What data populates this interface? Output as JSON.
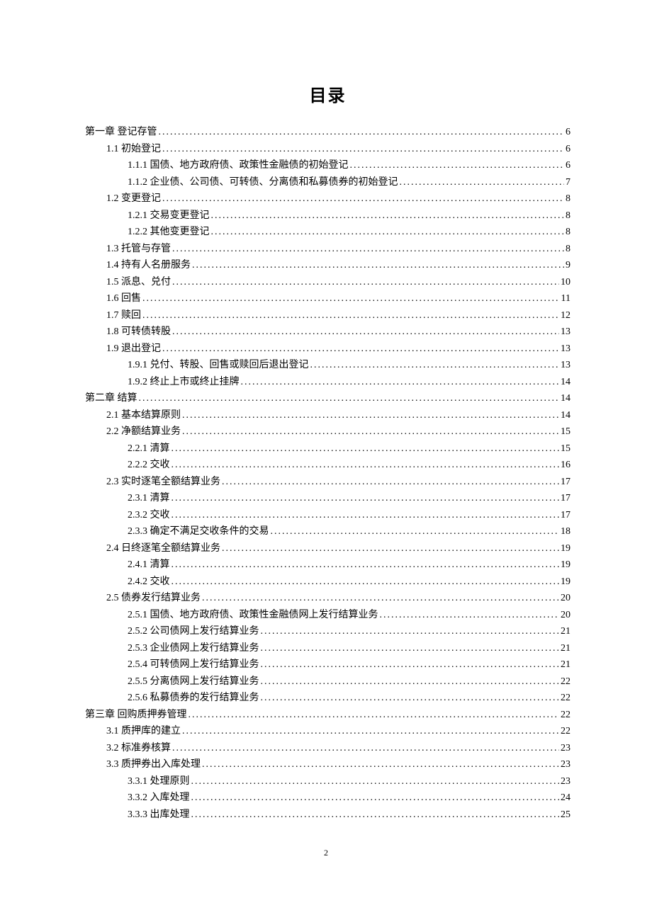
{
  "title": "目录",
  "page_number": "2",
  "entries": [
    {
      "level": 0,
      "label": "第一章  登记存管",
      "page": "6"
    },
    {
      "level": 1,
      "label": "1.1  初始登记",
      "page": "6"
    },
    {
      "level": 2,
      "label": "1.1.1 国债、地方政府债、政策性金融债的初始登记",
      "page": "6"
    },
    {
      "level": 2,
      "label": "1.1.2 企业债、公司债、可转债、分离债和私募债券的初始登记",
      "page": "7"
    },
    {
      "level": 1,
      "label": "1.2  变更登记",
      "page": "8"
    },
    {
      "level": 2,
      "label": "1.2.1 交易变更登记",
      "page": "8"
    },
    {
      "level": 2,
      "label": "1.2.2 其他变更登记",
      "page": "8"
    },
    {
      "level": 1,
      "label": "1.3  托管与存管",
      "page": "8"
    },
    {
      "level": 1,
      "label": "1.4  持有人名册服务",
      "page": "9"
    },
    {
      "level": 1,
      "label": "1.5  派息、兑付",
      "page": "10"
    },
    {
      "level": 1,
      "label": "1.6  回售",
      "page": "11"
    },
    {
      "level": 1,
      "label": "1.7  赎回",
      "page": "12"
    },
    {
      "level": 1,
      "label": "1.8 可转债转股",
      "page": "13"
    },
    {
      "level": 1,
      "label": "1.9 退出登记",
      "page": "13"
    },
    {
      "level": 2,
      "label": "1.9.1  兑付、转股、回售或赎回后退出登记",
      "page": "13"
    },
    {
      "level": 2,
      "label": "1.9.2  终止上市或终止挂牌",
      "page": "14"
    },
    {
      "level": 0,
      "label": "第二章  结算",
      "page": "14"
    },
    {
      "level": 1,
      "label": "2.1  基本结算原则",
      "page": "14"
    },
    {
      "level": 1,
      "label": "2.2  净额结算业务",
      "page": "15"
    },
    {
      "level": 2,
      "label": "2.2.1 清算",
      "page": "15"
    },
    {
      "level": 2,
      "label": "2.2.2  交收",
      "page": "16"
    },
    {
      "level": 1,
      "label": "2.3  实时逐笔全额结算业务",
      "page": "17"
    },
    {
      "level": 2,
      "label": "2.3.1  清算",
      "page": "17"
    },
    {
      "level": 2,
      "label": "2.3.2  交收",
      "page": "17"
    },
    {
      "level": 2,
      "label": "2.3.3  确定不满足交收条件的交易",
      "page": "18"
    },
    {
      "level": 1,
      "label": "2.4  日终逐笔全额结算业务",
      "page": "19"
    },
    {
      "level": 2,
      "label": "2.4.1  清算",
      "page": "19"
    },
    {
      "level": 2,
      "label": "2.4.2  交收",
      "page": "19"
    },
    {
      "level": 1,
      "label": "2.5  债券发行结算业务",
      "page": "20"
    },
    {
      "level": 2,
      "label": "2.5.1  国债、地方政府债、政策性金融债网上发行结算业务",
      "page": "20"
    },
    {
      "level": 2,
      "label": "2.5.2  公司债网上发行结算业务",
      "page": "21"
    },
    {
      "level": 2,
      "label": "2.5.3  企业债网上发行结算业务",
      "page": "21"
    },
    {
      "level": 2,
      "label": "2.5.4  可转债网上发行结算业务",
      "page": "21"
    },
    {
      "level": 2,
      "label": "2.5.5  分离债网上发行结算业务",
      "page": "22"
    },
    {
      "level": 2,
      "label": "2.5.6 私募债券的发行结算业务",
      "page": "22"
    },
    {
      "level": 0,
      "label": "第三章  回购质押券管理",
      "page": "22"
    },
    {
      "level": 1,
      "label": "3.1  质押库的建立",
      "page": "22"
    },
    {
      "level": 1,
      "label": "3.2  标准券核算",
      "page": "23"
    },
    {
      "level": 1,
      "label": "3.3  质押券出入库处理",
      "page": "23"
    },
    {
      "level": 2,
      "label": "3.3.1  处理原则",
      "page": "23"
    },
    {
      "level": 2,
      "label": "3.3.2 入库处理",
      "page": "24"
    },
    {
      "level": 2,
      "label": "3.3.3 出库处理",
      "page": "25"
    }
  ]
}
